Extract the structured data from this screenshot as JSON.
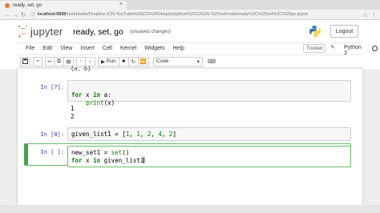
{
  "browser": {
    "tab_title": "ready, set, go",
    "tab_close": "×",
    "address_host": "localhost:8888",
    "address_path": "/notebooks/Dropbox (CN YouTube%20(C5%20Disquiz/python%2013%20-%20set/code/ready%2C%20set%2C%20go.ipynb",
    "back": "←",
    "forward": "→",
    "reload": "↻"
  },
  "header": {
    "logo_text": "jupyter",
    "notebook_title": "ready, set, go",
    "status": "(unsaved changes)",
    "logout_label": "Logout"
  },
  "menu": {
    "items": [
      "File",
      "Edit",
      "View",
      "Insert",
      "Cell",
      "Kernel",
      "Widgets",
      "Help"
    ],
    "trusted": "Trusted",
    "kernel": "Python 3"
  },
  "toolbar": {
    "run_label": "Run",
    "cell_type": "Code"
  },
  "cells": {
    "partial_output": "{a, b}",
    "c7_prompt": "In [7]:",
    "c7_line1": "for x in a:",
    "c7_line2": "    print(x)",
    "c7_out1": "1",
    "c7_out2": "2",
    "c8_prompt": "In [8]:",
    "c8_code": "given_list1 = [1, 1, 2, 4, 2]",
    "c9_prompt": "In [ ]:",
    "c9_line1": "new_set1 = set()",
    "c9_line2": "for x in given_list1"
  }
}
